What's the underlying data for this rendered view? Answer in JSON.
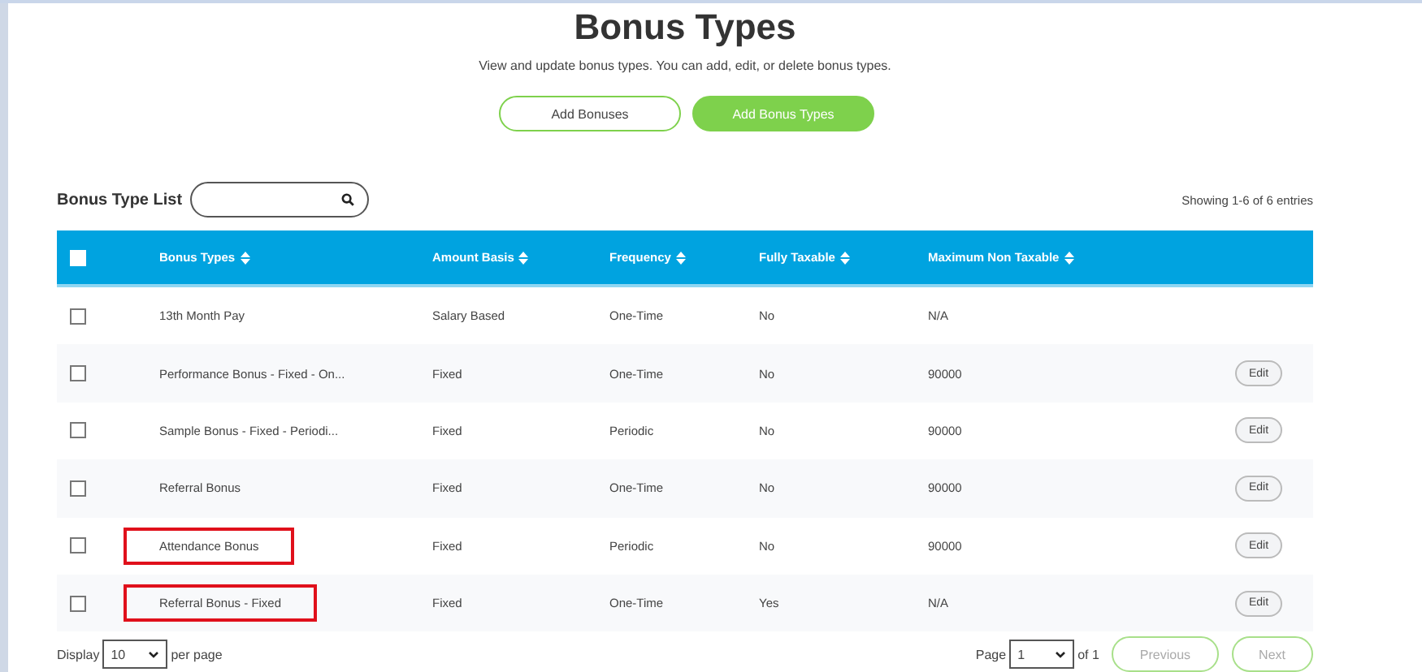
{
  "title": "Bonus Types",
  "subtitle": "View and update bonus types. You can add, edit, or delete bonus types.",
  "actions": [
    {
      "label": "Add Bonuses",
      "kind": "outline"
    },
    {
      "label": "Add Bonus Types",
      "kind": "filled"
    }
  ],
  "list_title": "Bonus Type List",
  "showing": "Showing 1-6 of 6 entries",
  "table": {
    "select_all": {
      "checked": false
    },
    "columns": [
      "Bonus Types",
      "Amount Basis",
      "Frequency",
      "Fully Taxable",
      "Maximum Non Taxable"
    ],
    "rows": [
      {
        "checked": false,
        "highlighted": false,
        "cells": [
          "13th Month Pay",
          "Salary Based",
          "One-Time",
          "No",
          "N/A"
        ]
      },
      {
        "checked": false,
        "highlighted": false,
        "cells": [
          "Performance Bonus - Fixed - On...",
          "Fixed",
          "One-Time",
          "No",
          "90000"
        ],
        "action": "Edit"
      },
      {
        "checked": false,
        "highlighted": false,
        "cells": [
          "Sample Bonus - Fixed - Periodi...",
          "Fixed",
          "Periodic",
          "No",
          "90000"
        ],
        "action": "Edit"
      },
      {
        "checked": false,
        "highlighted": false,
        "cells": [
          "Referral Bonus",
          "Fixed",
          "One-Time",
          "No",
          "90000"
        ],
        "action": "Edit"
      },
      {
        "checked": false,
        "highlighted": true,
        "cells": [
          "Attendance Bonus",
          "Fixed",
          "Periodic",
          "No",
          "90000"
        ],
        "action": "Edit"
      },
      {
        "checked": false,
        "highlighted": true,
        "cells": [
          "Referral Bonus - Fixed",
          "Fixed",
          "One-Time",
          "Yes",
          "N/A"
        ],
        "action": "Edit"
      }
    ]
  },
  "footer": {
    "display_label": "Display",
    "per_page": "10",
    "per_page_label": "per page",
    "page_label": "Page",
    "page": "1",
    "of_label": "of 1",
    "buttons": [
      {
        "label": "Previous",
        "disabled": true
      },
      {
        "label": "Next",
        "disabled": true
      }
    ]
  }
}
